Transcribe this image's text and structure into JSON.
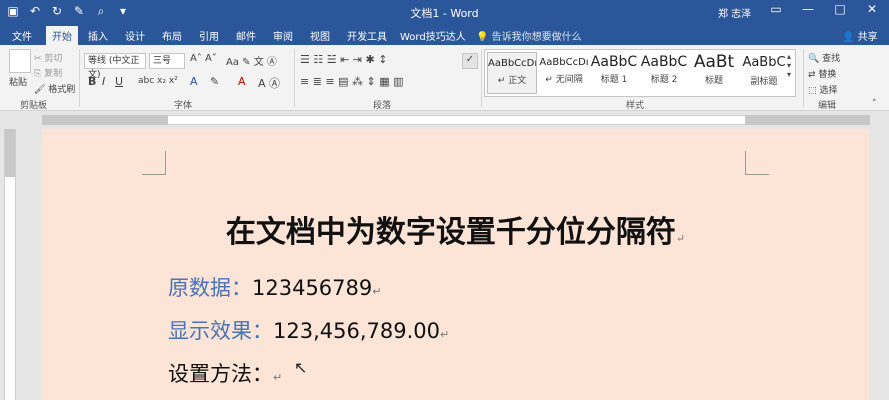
{
  "titlebar": {
    "doc_title": "文档1  -  Word",
    "user": "郑 志泽",
    "qat_icons": [
      "save-icon",
      "undo-icon",
      "redo-icon",
      "format-painter-icon",
      "print-preview-icon",
      "dropdown-icon"
    ]
  },
  "tabs": [
    "文件",
    "开始",
    "插入",
    "设计",
    "布局",
    "引用",
    "邮件",
    "审阅",
    "视图",
    "开发工具",
    "Word技巧达人"
  ],
  "active_tab": "开始",
  "tell_me": "告诉我你想要做什么",
  "share": "共享",
  "ribbon": {
    "clipboard": {
      "paste": "粘贴",
      "cut": "剪切",
      "copy": "复制",
      "painter": "格式刷",
      "label": "剪贴板"
    },
    "font": {
      "family": "等线 (中文正文)",
      "size": "三号",
      "label": "字体"
    },
    "paragraph": {
      "label": "段落"
    },
    "styles": {
      "label": "样式",
      "items": [
        {
          "sample": "AaBbCcDı",
          "name": "↵ 正文"
        },
        {
          "sample": "AaBbCcDı",
          "name": "↵ 无间隔"
        },
        {
          "sample": "AaBbC",
          "name": "标题 1"
        },
        {
          "sample": "AaBbC",
          "name": "标题 2"
        },
        {
          "sample": "AaBt",
          "name": "标题"
        },
        {
          "sample": "AaBbC",
          "name": "副标题"
        }
      ]
    },
    "editing": {
      "find": "查找",
      "replace": "替换",
      "select": "选择",
      "label": "编辑"
    }
  },
  "document": {
    "heading": "在文档中为数字设置千分位分隔符",
    "lines": [
      {
        "label": "原数据：",
        "value": "123456789"
      },
      {
        "label": "显示效果：",
        "value": "123,456,789.00"
      },
      {
        "label": "设置方法：",
        "value": ""
      }
    ]
  }
}
